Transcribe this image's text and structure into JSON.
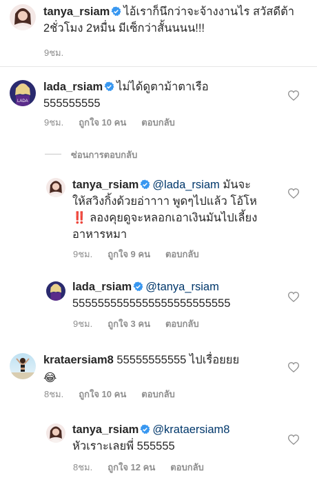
{
  "caption": {
    "username": "tanya_rsiam",
    "line1": "ไอ้เราก็นึกว่าจะจ้างงานไร สวัสดีต้า",
    "line2": "2ชั่วโมง 2หมื่น มีเซ็กว่าสั้นนนน!!!",
    "time": "9ชม."
  },
  "comments": [
    {
      "username": "lada_rsiam",
      "text1": "ไม่ได้ดูตาม้าตาเรือ",
      "text2": "555555555",
      "time": "9ชม.",
      "likes": "ถูกใจ 10 คน",
      "reply": "ตอบกลับ"
    }
  ],
  "hide_replies": "ซ่อนการตอบกลับ",
  "replies": [
    {
      "username": "tanya_rsiam",
      "mention": "@lada_rsiam",
      "text1": "มันจะ",
      "text2": "ให้สวิงกิ้งด้วยอ่าาาา พูดๆไปแล้ว โอ้โห",
      "text3_mark": "‼️",
      "text3": "ลองคุยดูจะหลอกเอาเงินมันไปเลี้ยง",
      "text4": "อาหารหมา",
      "time": "9ชม.",
      "likes": "ถูกใจ 9 คน",
      "reply": "ตอบกลับ"
    },
    {
      "username": "lada_rsiam",
      "mention": "@tanya_rsiam",
      "text2": "5555555555555555555555555",
      "time": "9ชม.",
      "likes": "ถูกใจ 3 คน",
      "reply": "ตอบกลับ"
    }
  ],
  "comment2": {
    "username": "krataersiam8",
    "text1": "55555555555 ไปเรื่อยยย",
    "emoji": "😂",
    "time": "8ชม.",
    "likes": "ถูกใจ 10 คน",
    "reply": "ตอบกลับ"
  },
  "reply3": {
    "username": "tanya_rsiam",
    "mention": "@krataersiam8",
    "text2": "หัวเราะเลยพี่ 555555",
    "time": "8ชม.",
    "likes": "ถูกใจ 12 คน",
    "reply": "ตอบกลับ"
  },
  "icons": {
    "verified": "verified-badge-icon",
    "like": "heart-outline-icon"
  },
  "colors": {
    "verified": "#3897f0",
    "text": "#262626",
    "meta": "#8e8e8e",
    "mention": "#00376b"
  }
}
